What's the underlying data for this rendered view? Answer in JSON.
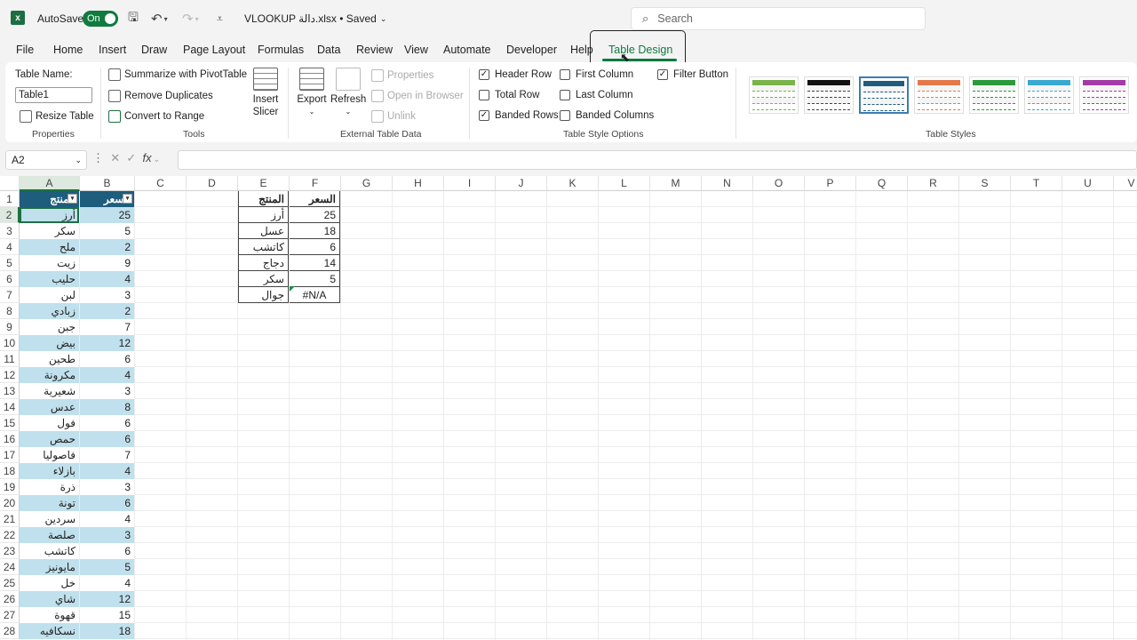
{
  "titlebar": {
    "autosave_label": "AutoSave",
    "toggle_label": "On",
    "filename": "VLOOKUP دالة.xlsx • Saved",
    "search_placeholder": "Search"
  },
  "menus": [
    "File",
    "Home",
    "Insert",
    "Draw",
    "Page Layout",
    "Formulas",
    "Data",
    "Review",
    "View",
    "Automate",
    "Developer",
    "Help",
    "Table Design"
  ],
  "ribbon": {
    "table_name_label": "Table Name:",
    "table_name_value": "Table1",
    "resize_table": "Resize Table",
    "properties_group": "Properties",
    "summarize_pivot": "Summarize with PivotTable",
    "remove_duplicates": "Remove Duplicates",
    "convert_to_range": "Convert to Range",
    "tools_group": "Tools",
    "insert_slicer_1": "Insert",
    "insert_slicer_2": "Slicer",
    "export": "Export",
    "refresh": "Refresh",
    "properties_btn": "Properties",
    "open_in_browser": "Open in Browser",
    "unlink": "Unlink",
    "external_group": "External Table Data",
    "header_row": "Header Row",
    "total_row": "Total Row",
    "banded_rows": "Banded Rows",
    "first_column": "First Column",
    "last_column": "Last Column",
    "banded_columns": "Banded Columns",
    "filter_button": "Filter Button",
    "style_options_group": "Table Style Options",
    "table_styles_group": "Table Styles",
    "check_mark": "✓"
  },
  "formula_bar": {
    "name_box": "A2",
    "fx": "fx"
  },
  "columns": [
    "A",
    "B",
    "C",
    "D",
    "E",
    "F",
    "G",
    "H",
    "I",
    "J",
    "K",
    "L",
    "M",
    "N",
    "O",
    "P",
    "Q",
    "R",
    "S",
    "T",
    "U",
    "V"
  ],
  "rows": [
    "1",
    "2",
    "3",
    "4",
    "5",
    "6",
    "7",
    "8",
    "9",
    "10",
    "11",
    "12",
    "13",
    "14",
    "15",
    "16",
    "17",
    "18",
    "19",
    "20",
    "21",
    "22",
    "23",
    "24",
    "25",
    "26",
    "27",
    "28"
  ],
  "table": {
    "header_a": "المنتج",
    "header_b": "السعر",
    "a": [
      "أرز",
      "سكر",
      "ملح",
      "زيت",
      "حليب",
      "لبن",
      "زبادي",
      "جبن",
      "بيض",
      "طحين",
      "مكرونة",
      "شعيرية",
      "عدس",
      "فول",
      "حمص",
      "فاصوليا",
      "بازلاء",
      "ذرة",
      "تونة",
      "سردين",
      "صلصة",
      "كاتشب",
      "مايونيز",
      "خل",
      "شاي",
      "قهوة",
      "نسكافيه"
    ],
    "b": [
      "25",
      "5",
      "2",
      "9",
      "4",
      "3",
      "2",
      "7",
      "12",
      "6",
      "4",
      "3",
      "8",
      "6",
      "6",
      "7",
      "4",
      "3",
      "6",
      "4",
      "3",
      "6",
      "5",
      "4",
      "12",
      "15",
      "18"
    ]
  },
  "lookup": {
    "header_e": "المنتج",
    "header_f": "السعر",
    "e": [
      "أرز",
      "عسل",
      "كاتشب",
      "دجاج",
      "سكر",
      "جوال"
    ],
    "f": [
      "25",
      "18",
      "6",
      "14",
      "5",
      "#N/A"
    ]
  }
}
